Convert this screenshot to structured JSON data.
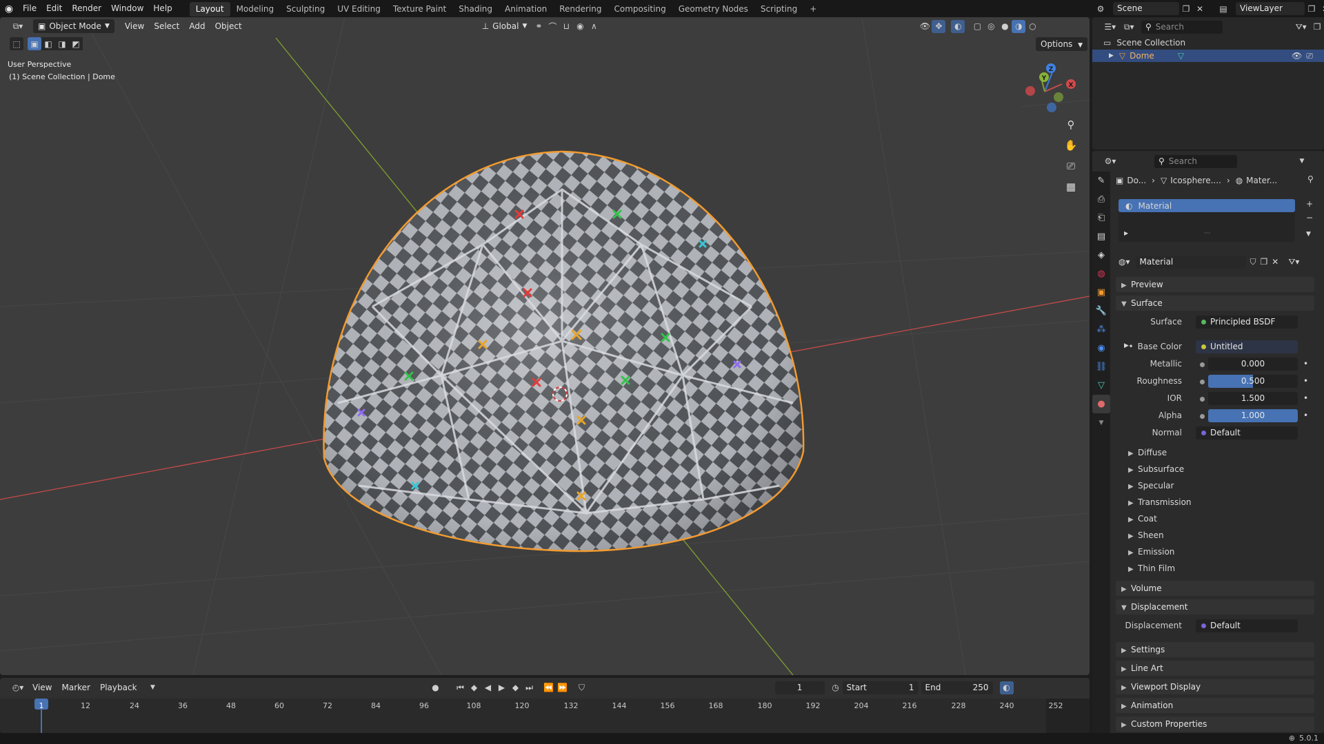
{
  "topbar": {
    "menus": [
      "File",
      "Edit",
      "Render",
      "Window",
      "Help"
    ],
    "workspaces": [
      "Layout",
      "Modeling",
      "Sculpting",
      "UV Editing",
      "Texture Paint",
      "Shading",
      "Animation",
      "Rendering",
      "Compositing",
      "Geometry Nodes",
      "Scripting"
    ],
    "active_workspace": "Layout",
    "add_tab": "+",
    "scene_name": "Scene",
    "view_layer": "ViewLayer"
  },
  "viewport": {
    "mode": "Object Mode",
    "menus": [
      "View",
      "Select",
      "Add",
      "Object"
    ],
    "transform_orientation": "Global",
    "options_label": "Options",
    "overlay_line1": "User Perspective",
    "overlay_line2": "(1) Scene Collection | Dome",
    "gizmo": {
      "x": "X",
      "y": "Y",
      "z": "Z"
    }
  },
  "timeline": {
    "menus": [
      "View",
      "Marker",
      "Playback"
    ],
    "current_frame": "1",
    "start_label": "Start",
    "start_value": "1",
    "end_label": "End",
    "end_value": "250",
    "ticks": [
      "1",
      "12",
      "24",
      "36",
      "48",
      "60",
      "72",
      "84",
      "96",
      "108",
      "120",
      "132",
      "144",
      "156",
      "168",
      "180",
      "192",
      "204",
      "216",
      "228",
      "240",
      "252"
    ]
  },
  "outliner": {
    "search_placeholder": "Search",
    "collection": "Scene Collection",
    "object": "Dome"
  },
  "properties": {
    "search_placeholder": "Search",
    "breadcrumb": [
      "Do...",
      "Icosphere....",
      "Mater..."
    ],
    "slot_name": "Material",
    "material_name": "Material",
    "panels": {
      "preview": "Preview",
      "surface": "Surface",
      "volume": "Volume",
      "displacement": "Displacement",
      "settings": "Settings",
      "line_art": "Line Art",
      "viewport_display": "Viewport Display",
      "animation": "Animation",
      "custom_properties": "Custom Properties"
    },
    "surface_fields": {
      "surface_label": "Surface",
      "surface_value": "Principled BSDF",
      "base_color_label": "Base Color",
      "base_color_value": "Untitled",
      "metallic_label": "Metallic",
      "metallic_value": "0.000",
      "roughness_label": "Roughness",
      "roughness_value": "0.500",
      "ior_label": "IOR",
      "ior_value": "1.500",
      "alpha_label": "Alpha",
      "alpha_value": "1.000",
      "normal_label": "Normal",
      "normal_value": "Default"
    },
    "slider_fill": {
      "metallic": 0.0,
      "roughness": 0.5,
      "ior": 0.0,
      "alpha": 1.0
    },
    "subpanels": [
      "Diffuse",
      "Subsurface",
      "Specular",
      "Transmission",
      "Coat",
      "Sheen",
      "Emission",
      "Thin Film"
    ],
    "displacement_fields": {
      "label": "Displacement",
      "value": "Default"
    }
  },
  "statusbar": {
    "version": "5.0.1"
  },
  "colors": {
    "accent": "#4772b3",
    "selection_outline": "#f29b30",
    "x_axis": "#c94a4a",
    "y_axis": "#7ea12e",
    "z_axis": "#3c7bd8"
  }
}
